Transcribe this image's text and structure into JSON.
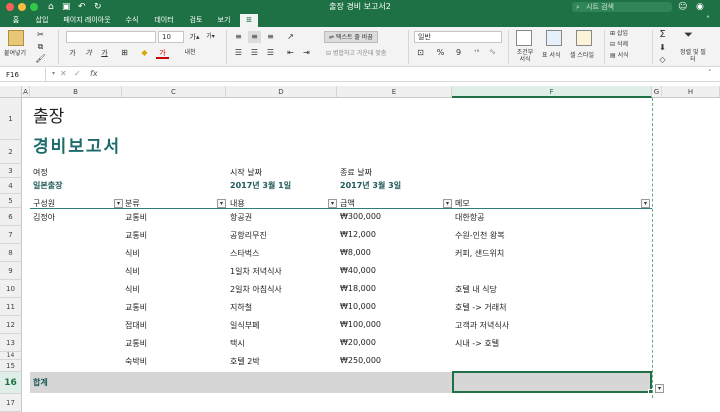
{
  "window": {
    "title": "출장 경비 보고서2",
    "search_placeholder": "시트 검색"
  },
  "tabs": [
    {
      "label": "홈",
      "active": true
    },
    {
      "label": "삽입"
    },
    {
      "label": "페이지 레이아웃"
    },
    {
      "label": "수식"
    },
    {
      "label": "데이터"
    },
    {
      "label": "검토"
    },
    {
      "label": "보기"
    },
    {
      "label": "표"
    }
  ],
  "ribbon": {
    "paste_label": "붙여넣기",
    "font_size": "10",
    "grow_font": "가",
    "shrink_font": "가",
    "bold": "가",
    "italic": "가",
    "underline": "가",
    "font_color": "가",
    "phonetic": "내천",
    "wrap_text": "텍스트 줄 바꿈",
    "merge_center": "병합하고 가운데 맞춤",
    "number_format": "일반",
    "percent": "%",
    "comma": "9",
    "conditional_format": "조건부 서식",
    "table_format": "표 서식",
    "cell_styles": "셀 스타일",
    "insert": "삽입",
    "delete": "삭제",
    "format": "서식",
    "sort_filter": "정렬 및 필터"
  },
  "formula_bar": {
    "name_box": "F16",
    "fx": "fx",
    "value": ""
  },
  "columns": [
    "A",
    "B",
    "C",
    "D",
    "E",
    "F",
    "G",
    "H"
  ],
  "rows": [
    "1",
    "2",
    "3",
    "4",
    "5",
    "6",
    "7",
    "8",
    "9",
    "10",
    "11",
    "12",
    "13",
    "14",
    "15",
    "16",
    "17"
  ],
  "sheet": {
    "title_line1": "출장",
    "title_line2": "경비보고서",
    "trip_label": "여정",
    "trip_value": "일본출장",
    "start_label": "시작 날짜",
    "start_value": "2017년 3월 1일",
    "end_label": "종료 날짜",
    "end_value": "2017년 3월 3일",
    "headers": [
      "구성원",
      "분류",
      "내용",
      "금액",
      "메모"
    ],
    "data_rows": [
      {
        "member": "김정아",
        "category": "교통비",
        "desc": "항공권",
        "amount": "₩300,000",
        "memo": "대한항공"
      },
      {
        "member": "",
        "category": "교통비",
        "desc": "공항리무진",
        "amount": "₩12,000",
        "memo": "수원-인천 왕복"
      },
      {
        "member": "",
        "category": "식비",
        "desc": "스타벅스",
        "amount": "₩8,000",
        "memo": "커피, 샌드위치"
      },
      {
        "member": "",
        "category": "식비",
        "desc": "1일차 저녁식사",
        "amount": "₩40,000",
        "memo": ""
      },
      {
        "member": "",
        "category": "식비",
        "desc": "2일차 아침식사",
        "amount": "₩18,000",
        "memo": "호텔 내 식당"
      },
      {
        "member": "",
        "category": "교통비",
        "desc": "지하철",
        "amount": "₩10,000",
        "memo": "호텔 -> 거래처"
      },
      {
        "member": "",
        "category": "접대비",
        "desc": "일식부페",
        "amount": "₩100,000",
        "memo": "고객과 저녁식사"
      },
      {
        "member": "",
        "category": "교통비",
        "desc": "택시",
        "amount": "₩20,000",
        "memo": "시내 -> 호텔"
      },
      {
        "member": "",
        "category": "숙박비",
        "desc": "호텔 2박",
        "amount": "₩250,000",
        "memo": ""
      }
    ],
    "total_label": "합계"
  },
  "colors": {
    "brand": "#1e7145",
    "teal": "#1e6b6b"
  }
}
